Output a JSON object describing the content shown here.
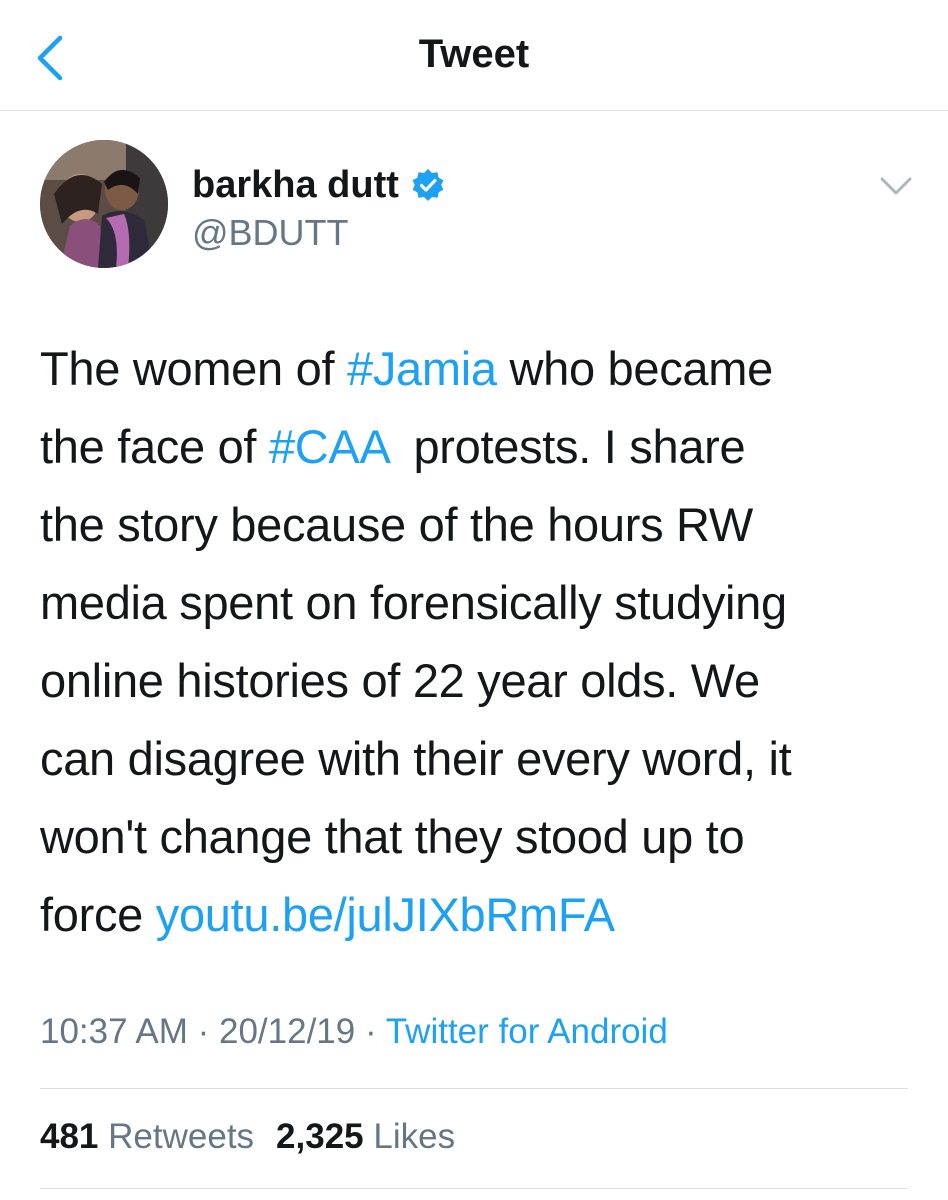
{
  "header": {
    "title": "Tweet",
    "back_icon": "chevron-left-icon"
  },
  "author": {
    "display_name": "barkha dutt",
    "handle": "@BDUTT",
    "verified_icon": "verified-badge-icon",
    "menu_icon": "chevron-down-icon"
  },
  "tweet": {
    "lines": [
      {
        "pre": "The women of ",
        "tag": "#Jamia",
        "post": " who became"
      },
      {
        "pre": "the face of ",
        "tag": "#CAA",
        "post": "  protests. I share"
      },
      {
        "text": "the story because of the hours RW"
      },
      {
        "text": "media spent on forensically studying"
      },
      {
        "text": "online histories of 22 year olds. We"
      },
      {
        "text": "can disagree with their every word, it"
      },
      {
        "text": "won't change that they stood up to"
      },
      {
        "pre": "force ",
        "link": "youtu.be/julJIXbRmFA"
      }
    ]
  },
  "meta": {
    "time": "10:37 AM",
    "sep1": " · ",
    "date": "20/12/19",
    "sep2": " · ",
    "source": "Twitter for Android"
  },
  "stats": {
    "retweets_count": "481",
    "retweets_label": "Retweets",
    "likes_count": "2,325",
    "likes_label": "Likes"
  },
  "colors": {
    "accent": "#1da1f2",
    "text": "#14171a",
    "secondary": "#657786",
    "divider": "#dcdfe2"
  }
}
